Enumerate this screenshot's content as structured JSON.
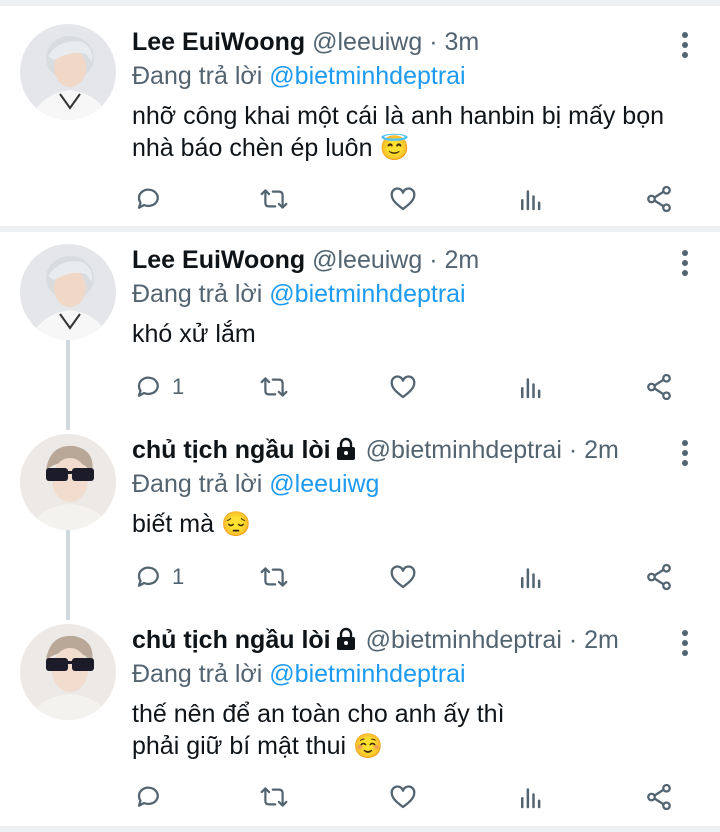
{
  "tweets": [
    {
      "name": "Lee EuiWoong",
      "handle": "@leeuiwg",
      "time": "3m",
      "replying_prefix": "Đang trả lời",
      "replying_to": "@bietminhdeptrai",
      "text": "nhỡ công khai một cái là anh hanbin bị mấy bọn nhà báo chèn ép luôn",
      "emoji": "😇",
      "reply_count": ""
    },
    {
      "name": "Lee EuiWoong",
      "handle": "@leeuiwg",
      "time": "2m",
      "replying_prefix": "Đang trả lời",
      "replying_to": "@bietminhdeptrai",
      "text": "khó xử lắm",
      "emoji": "",
      "reply_count": "1"
    },
    {
      "name": "chủ tịch ngầu lòi",
      "handle": "@bietminhdeptrai",
      "time": "2m",
      "replying_prefix": "Đang trả lời",
      "replying_to": "@leeuiwg",
      "text": "biết mà",
      "emoji": "😔",
      "reply_count": "1"
    },
    {
      "name": "chủ tịch ngầu lòi",
      "handle": "@bietminhdeptrai",
      "time": "2m",
      "replying_prefix": "Đang trả lời",
      "replying_to": "@bietminhdeptrai",
      "text": "thế nên để an toàn cho anh ấy thì phải giữ bí mật thui",
      "emoji": "☺️",
      "reply_count": ""
    }
  ],
  "separator": "·",
  "icons": [
    "reply-icon",
    "retweet-icon",
    "like-icon",
    "analytics-icon",
    "share-icon",
    "more-icon",
    "lock-icon"
  ],
  "colors": {
    "mention": "#1d9bf0",
    "secondary": "#536471",
    "text": "#0f1419"
  }
}
